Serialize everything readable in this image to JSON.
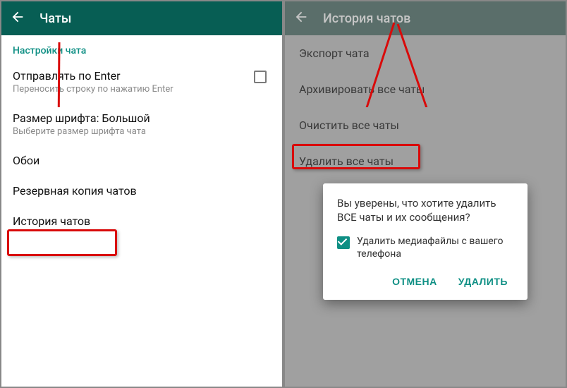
{
  "left": {
    "header_title": "Чаты",
    "section_label": "Настройки чата",
    "enter_send": {
      "title": "Отправлять по Enter",
      "sub": "Переносить строку по нажатию Enter"
    },
    "font_size": {
      "title": "Размер шрифта: Большой",
      "sub": "Выберите размер шрифта чата"
    },
    "wallpaper": {
      "title": "Обои"
    },
    "backup": {
      "title": "Резервная копия чатов"
    },
    "history": {
      "title": "История чатов"
    }
  },
  "right": {
    "header_title": "История чатов",
    "export": {
      "title": "Экспорт чата"
    },
    "archive": {
      "title": "Архивировать все чаты"
    },
    "clear": {
      "title": "Очистить все чаты"
    },
    "delete": {
      "title": "Удалить все чаты"
    },
    "dialog": {
      "message": "Вы уверены, что хотите удалить ВСЕ чаты и их сообщения?",
      "check_label": "Удалить медиафайлы с вашего телефона",
      "cancel": "ОТМЕНА",
      "confirm": "УДАЛИТЬ"
    }
  }
}
